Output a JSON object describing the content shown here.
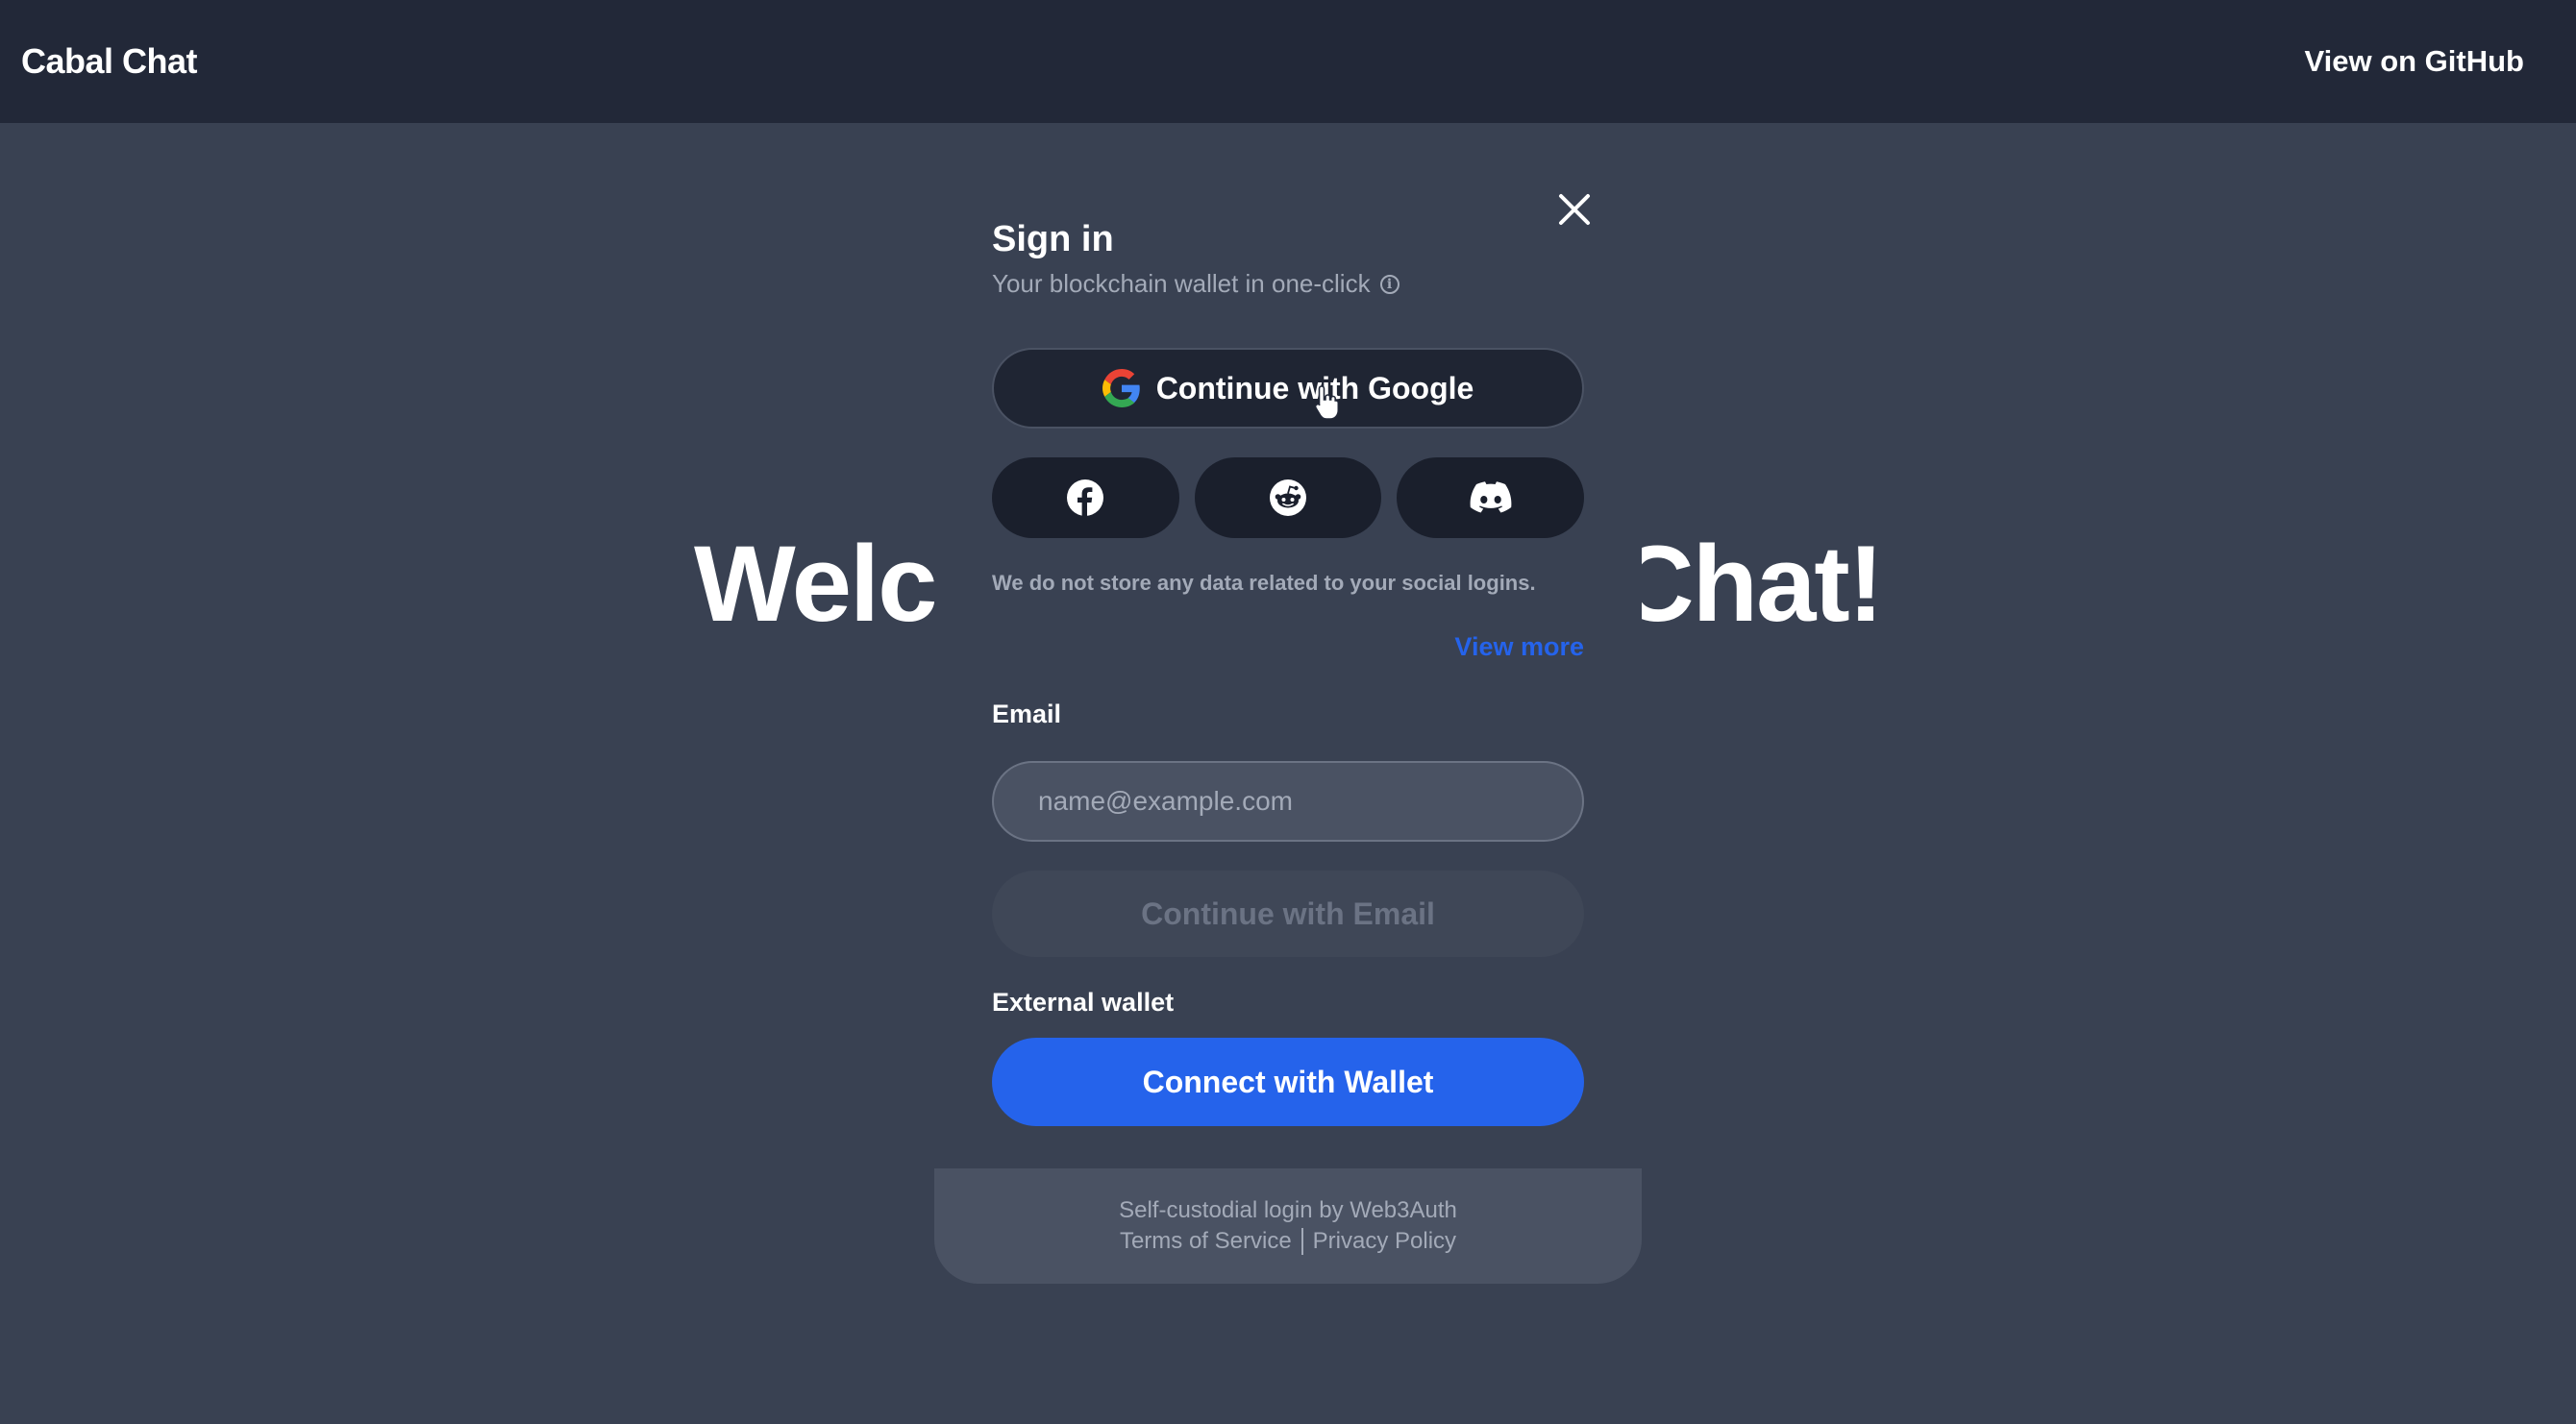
{
  "navbar": {
    "brand": "Cabal Chat",
    "github_link": "View on GitHub"
  },
  "hero": {
    "text": "Welcome to Cabal Chat!"
  },
  "modal": {
    "title": "Sign in",
    "subtitle": "Your blockchain wallet in one-click",
    "google_button": "Continue with Google",
    "social_buttons": [
      {
        "name": "facebook",
        "icon": "facebook-icon"
      },
      {
        "name": "reddit",
        "icon": "reddit-icon"
      },
      {
        "name": "discord",
        "icon": "discord-icon"
      }
    ],
    "disclaimer": "We do not store any data related to your social logins.",
    "view_more": "View more",
    "email_label": "Email",
    "email_placeholder": "name@example.com",
    "email_button": "Continue with Email",
    "wallet_label": "External wallet",
    "wallet_button": "Connect with Wallet",
    "footer": {
      "powered_by": "Self-custodial login by Web3Auth",
      "terms": "Terms of Service",
      "privacy": "Privacy Policy"
    }
  },
  "colors": {
    "background": "#394152",
    "navbar": "#222838",
    "accent": "#2563eb",
    "dark_button": "#1a1f2c"
  }
}
